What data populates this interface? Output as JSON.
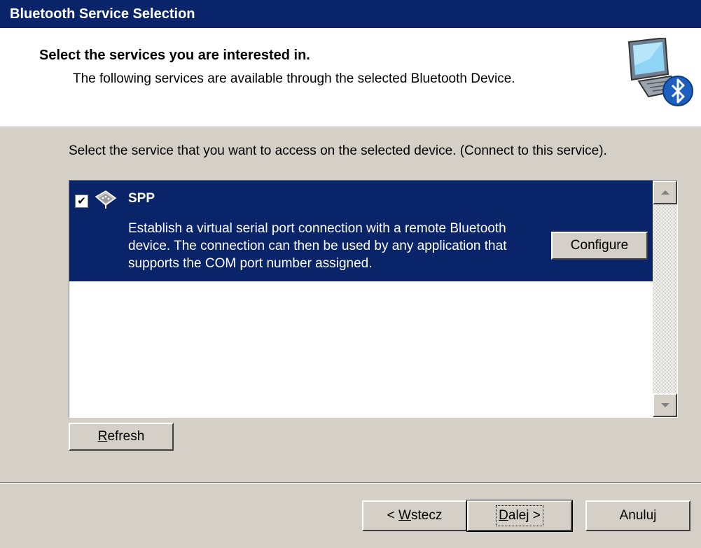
{
  "window": {
    "title": "Bluetooth Service Selection"
  },
  "header": {
    "title": "Select the services you are interested in.",
    "subtitle": "The following services are available through the selected Bluetooth Device.",
    "icon": "bluetooth-computer-icon"
  },
  "instructions": "Select the service that you want to access on the selected device. (Connect to this service).",
  "services": [
    {
      "name": "SPP",
      "checked": true,
      "icon": "serial-port-icon",
      "description": "Establish a virtual serial port connection with a remote Bluetooth device. The connection can then be used by any application that supports the COM port number assigned.",
      "configure_label": "Configure"
    }
  ],
  "buttons": {
    "refresh_prefix": "",
    "refresh_hotkey": "R",
    "refresh_rest": "efresh",
    "back_prefix": "< ",
    "back_hotkey": "W",
    "back_rest": "stecz",
    "next_prefix": "",
    "next_hotkey": "D",
    "next_rest": "alej >",
    "cancel": "Anuluj"
  },
  "colors": {
    "title_bar": "#0a246a",
    "selection": "#0a246a",
    "dialog_bg": "#d4d0c8",
    "bluetooth_blue": "#1d5fbf"
  }
}
